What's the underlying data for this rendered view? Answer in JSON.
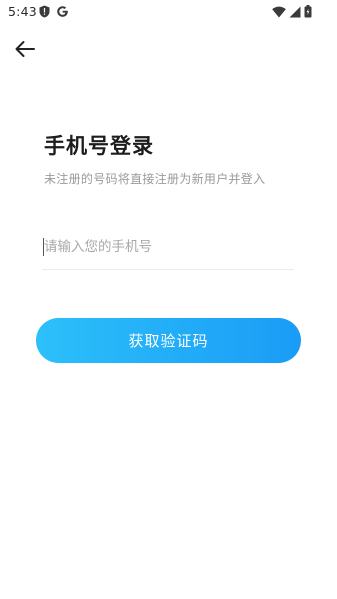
{
  "status_bar": {
    "time": "5:43",
    "left_icons": [
      "shield-alert-icon",
      "google-g-icon"
    ],
    "right_icons": [
      "wifi-icon",
      "cell-signal-icon",
      "battery-icon"
    ]
  },
  "nav": {
    "back_icon": "arrow-left-icon"
  },
  "login": {
    "title": "手机号登录",
    "subtitle": "未注册的号码将直接注册为新用户并登入",
    "phone_placeholder": "请输入您的手机号",
    "phone_value": "",
    "get_code_label": "获取验证码"
  },
  "colors": {
    "button_gradient_start": "#2cc0fa",
    "button_gradient_end": "#1a9cf6",
    "title": "#1c1c1c",
    "subtitle": "#9a9a9a",
    "placeholder": "#a8a8a8"
  }
}
